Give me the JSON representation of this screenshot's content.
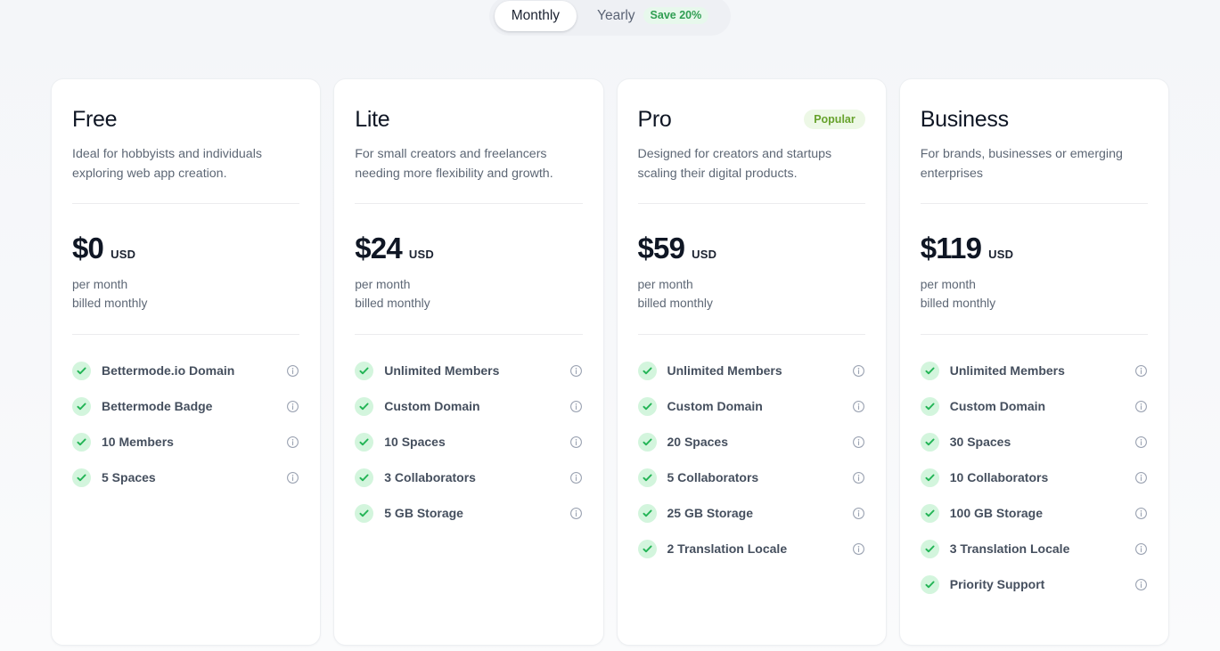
{
  "billing_toggle": {
    "options": [
      {
        "label": "Monthly",
        "active": true,
        "badge": null
      },
      {
        "label": "Yearly",
        "active": false,
        "badge": "Save 20%"
      }
    ]
  },
  "colors": {
    "page_bg": "#f6f8fa",
    "card_bg": "#ffffff",
    "card_border": "#edeff2",
    "accent_green": "#2f9e52",
    "check_bg": "#d3f5dd",
    "check_mark": "#22b455",
    "popular_bg": "#edf8e6",
    "popular_text": "#67a22c",
    "save_badge_bg": "#e7f8ec",
    "save_badge_text": "#2f9e52",
    "heading": "#0f1624",
    "body_text": "#5d6775",
    "feature_text": "#454f5e",
    "info_icon": "#8a93a5",
    "divider": "#ececee"
  },
  "icons": {
    "check": "check-circle-icon",
    "info": "info-circle-icon"
  },
  "plans": [
    {
      "name": "Free",
      "badge": null,
      "description": "Ideal for hobbyists and individuals exploring web app creation.",
      "price": "$0",
      "currency": "USD",
      "period": "per month",
      "billing_note": "billed monthly",
      "features": [
        "Bettermode.io Domain",
        "Bettermode Badge",
        "10 Members",
        "5 Spaces"
      ]
    },
    {
      "name": "Lite",
      "badge": null,
      "description": "For small creators and freelancers needing more flexibility and growth.",
      "price": "$24",
      "currency": "USD",
      "period": "per month",
      "billing_note": "billed monthly",
      "features": [
        "Unlimited Members",
        "Custom Domain",
        "10 Spaces",
        "3 Collaborators",
        "5 GB Storage"
      ]
    },
    {
      "name": "Pro",
      "badge": "Popular",
      "description": "Designed for creators and startups scaling their digital products.",
      "price": "$59",
      "currency": "USD",
      "period": "per month",
      "billing_note": "billed monthly",
      "features": [
        "Unlimited Members",
        "Custom Domain",
        "20 Spaces",
        "5 Collaborators",
        "25 GB Storage",
        "2 Translation Locale"
      ]
    },
    {
      "name": "Business",
      "badge": null,
      "description": "For brands, businesses or emerging enterprises",
      "price": "$119",
      "currency": "USD",
      "period": "per month",
      "billing_note": "billed monthly",
      "features": [
        "Unlimited Members",
        "Custom Domain",
        "30 Spaces",
        "10 Collaborators",
        "100 GB Storage",
        "3 Translation Locale",
        "Priority Support"
      ]
    }
  ]
}
